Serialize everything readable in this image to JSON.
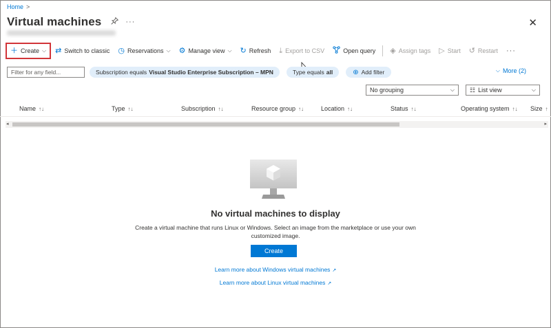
{
  "breadcrumb": {
    "home": "Home",
    "separator": ">"
  },
  "header": {
    "title": "Virtual machines",
    "pin_icon": "pin-icon",
    "more_icon": "ellipsis-icon",
    "close_icon": "close-icon"
  },
  "toolbar": {
    "create": "Create",
    "switch_classic": "Switch to classic",
    "reservations": "Reservations",
    "manage_view": "Manage view",
    "refresh": "Refresh",
    "export_csv": "Export to CSV",
    "open_query": "Open query",
    "assign_tags": "Assign tags",
    "start": "Start",
    "restart": "Restart"
  },
  "filters": {
    "placeholder": "Filter for any field...",
    "subscription_prefix": "Subscription equals",
    "subscription_value": "Visual Studio Enterprise Subscription – MPN",
    "type_prefix": "Type equals",
    "type_value": "all",
    "add_filter": "Add filter",
    "more": "More (2)"
  },
  "grouping": {
    "selected": "No grouping"
  },
  "view": {
    "selected": "List view"
  },
  "columns": [
    {
      "label": "Name",
      "sort": "↑↓"
    },
    {
      "label": "Type",
      "sort": "↑↓"
    },
    {
      "label": "Subscription",
      "sort": "↑↓"
    },
    {
      "label": "Resource group",
      "sort": "↑↓"
    },
    {
      "label": "Location",
      "sort": "↑↓"
    },
    {
      "label": "Status",
      "sort": "↑↓"
    },
    {
      "label": "Operating system",
      "sort": "↑↓"
    },
    {
      "label": "Size",
      "sort": "↑"
    }
  ],
  "empty_state": {
    "title": "No virtual machines to display",
    "description": "Create a virtual machine that runs Linux or Windows. Select an image from the marketplace or use your own customized image.",
    "create_button": "Create",
    "link_windows": "Learn more about Windows virtual machines",
    "link_linux": "Learn more about Linux virtual machines"
  },
  "colors": {
    "accent": "#0078d4",
    "highlight_border": "#d13438",
    "pill_bg": "#e1eefa"
  }
}
